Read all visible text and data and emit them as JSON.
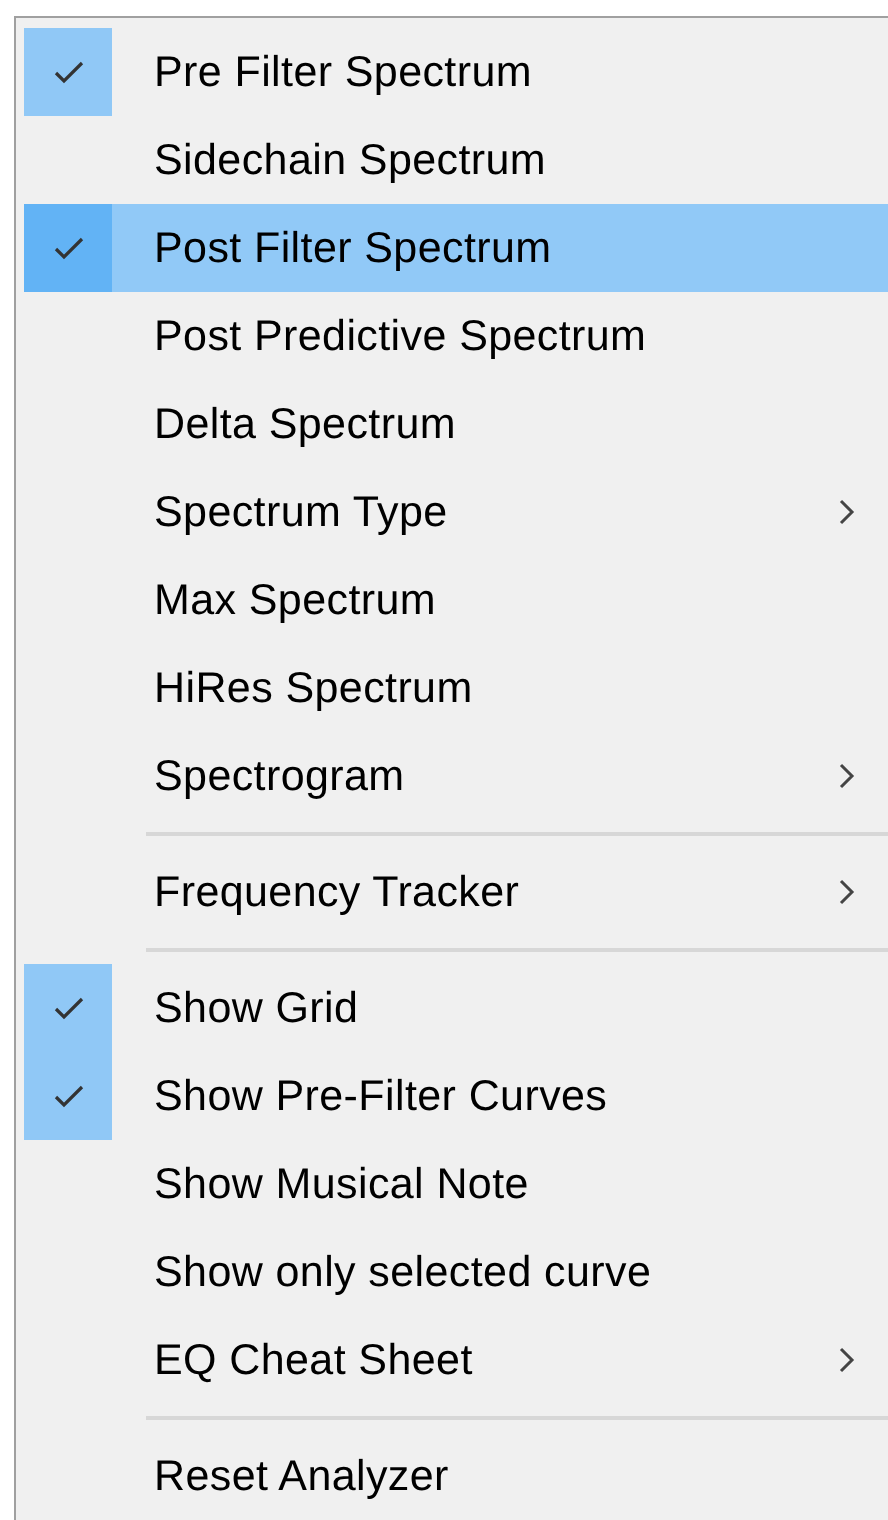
{
  "menu": {
    "groups": [
      {
        "items": [
          {
            "label": "Pre Filter Spectrum",
            "checked": true,
            "selected": false,
            "submenu": false
          },
          {
            "label": "Sidechain Spectrum",
            "checked": false,
            "selected": false,
            "submenu": false
          },
          {
            "label": "Post Filter Spectrum",
            "checked": true,
            "selected": true,
            "submenu": false
          },
          {
            "label": "Post Predictive Spectrum",
            "checked": false,
            "selected": false,
            "submenu": false
          },
          {
            "label": "Delta Spectrum",
            "checked": false,
            "selected": false,
            "submenu": false
          },
          {
            "label": "Spectrum Type",
            "checked": false,
            "selected": false,
            "submenu": true
          },
          {
            "label": "Max Spectrum",
            "checked": false,
            "selected": false,
            "submenu": false
          },
          {
            "label": "HiRes Spectrum",
            "checked": false,
            "selected": false,
            "submenu": false
          },
          {
            "label": "Spectrogram",
            "checked": false,
            "selected": false,
            "submenu": true
          }
        ]
      },
      {
        "items": [
          {
            "label": "Frequency Tracker",
            "checked": false,
            "selected": false,
            "submenu": true
          }
        ]
      },
      {
        "items": [
          {
            "label": "Show Grid",
            "checked": true,
            "selected": false,
            "submenu": false
          },
          {
            "label": "Show Pre-Filter Curves",
            "checked": true,
            "selected": false,
            "submenu": false
          },
          {
            "label": "Show Musical Note",
            "checked": false,
            "selected": false,
            "submenu": false
          },
          {
            "label": "Show only selected curve",
            "checked": false,
            "selected": false,
            "submenu": false
          },
          {
            "label": "EQ Cheat Sheet",
            "checked": false,
            "selected": false,
            "submenu": true
          }
        ]
      },
      {
        "items": [
          {
            "label": "Reset Analyzer",
            "checked": false,
            "selected": false,
            "submenu": false
          }
        ]
      }
    ]
  }
}
